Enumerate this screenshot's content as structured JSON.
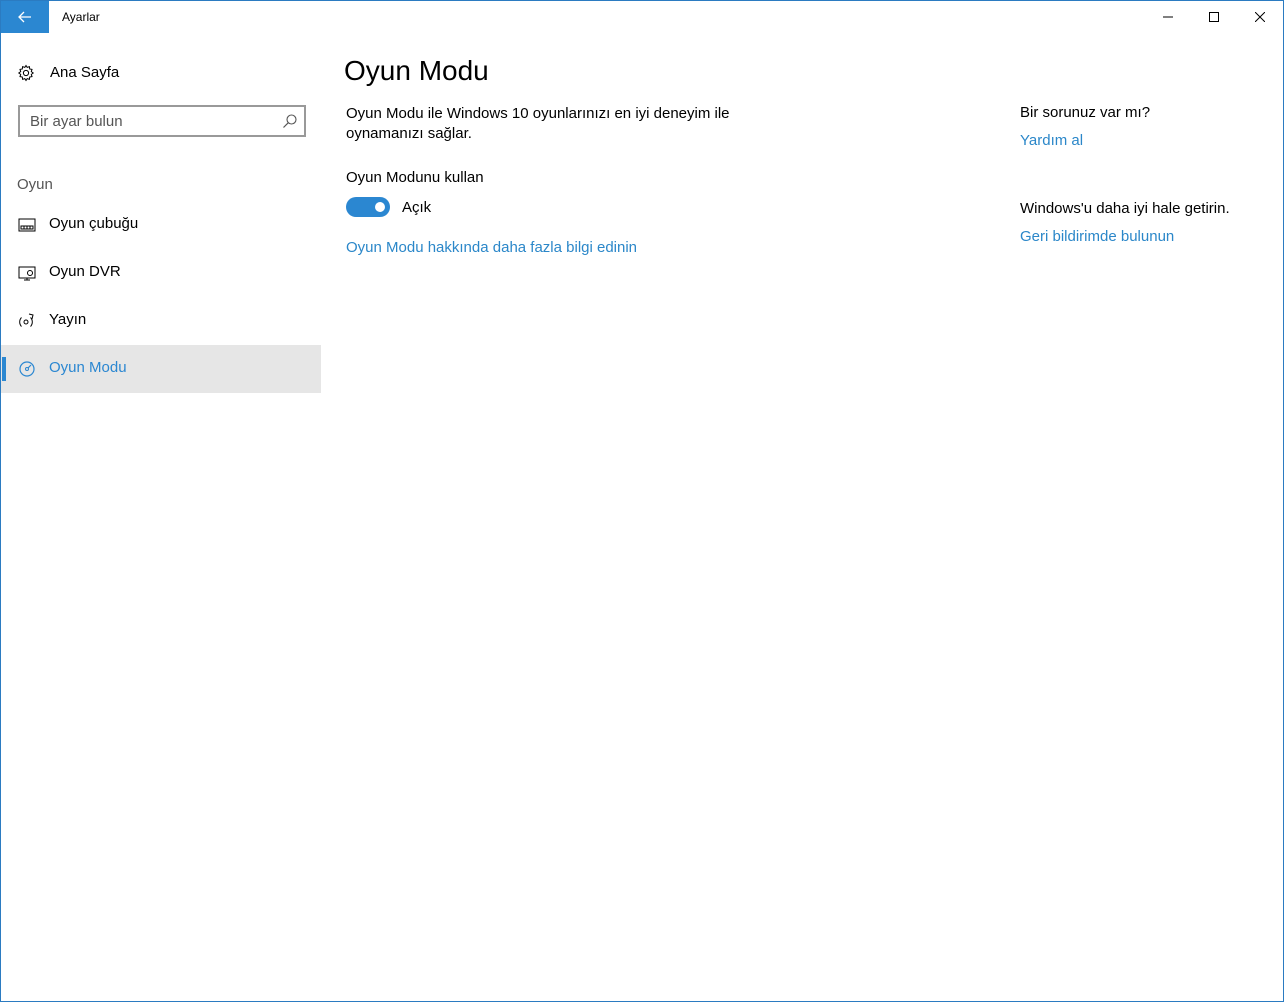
{
  "window": {
    "title": "Ayarlar",
    "accent": "#2b87d1"
  },
  "sidebar": {
    "home_label": "Ana Sayfa",
    "search_placeholder": "Bir ayar bulun",
    "section_label": "Oyun",
    "items": [
      {
        "label": "Oyun çubuğu",
        "icon": "game-bar-icon",
        "selected": false
      },
      {
        "label": "Oyun DVR",
        "icon": "game-dvr-icon",
        "selected": false
      },
      {
        "label": "Yayın",
        "icon": "broadcast-icon",
        "selected": false
      },
      {
        "label": "Oyun Modu",
        "icon": "game-mode-icon",
        "selected": true
      }
    ]
  },
  "main": {
    "title": "Oyun Modu",
    "description": "Oyun Modu ile Windows 10 oyunlarınızı en iyi deneyim ile oynamanızı sağlar.",
    "toggle_title": "Oyun Modunu kullan",
    "toggle_state": "Açık",
    "toggle_on": true,
    "more_link": "Oyun Modu hakkında daha fazla bilgi edinin"
  },
  "related": {
    "question": "Bir sorunuz var mı?",
    "help_link": "Yardım al",
    "improve": "Windows'u daha iyi hale getirin.",
    "feedback_link": "Geri bildirimde bulunun"
  }
}
